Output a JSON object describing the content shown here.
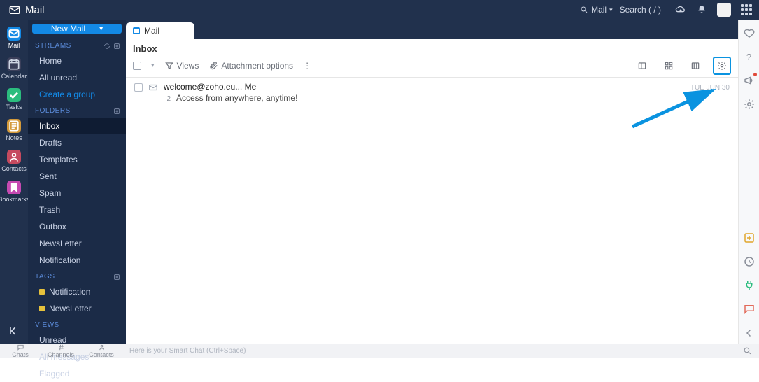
{
  "brand": {
    "title": "Mail"
  },
  "topsearch": {
    "scope": "Mail",
    "placeholder": "Search ( / )"
  },
  "rail": [
    {
      "key": "mail",
      "label": "Mail",
      "active": true
    },
    {
      "key": "calendar",
      "label": "Calendar"
    },
    {
      "key": "tasks",
      "label": "Tasks"
    },
    {
      "key": "notes",
      "label": "Notes"
    },
    {
      "key": "contacts",
      "label": "Contacts"
    },
    {
      "key": "bookmarks",
      "label": "Bookmarks"
    }
  ],
  "compose_label": "New Mail",
  "sidebar": {
    "streams_title": "STREAMS",
    "streams": [
      {
        "label": "Home"
      },
      {
        "label": "All unread"
      },
      {
        "label": "Create a group",
        "link": true
      }
    ],
    "folders_title": "FOLDERS",
    "folders": [
      {
        "label": "Inbox",
        "active": true
      },
      {
        "label": "Drafts"
      },
      {
        "label": "Templates"
      },
      {
        "label": "Sent"
      },
      {
        "label": "Spam"
      },
      {
        "label": "Trash"
      },
      {
        "label": "Outbox"
      },
      {
        "label": "NewsLetter"
      },
      {
        "label": "Notification"
      }
    ],
    "tags_title": "TAGS",
    "tags": [
      {
        "label": "Notification"
      },
      {
        "label": "NewsLetter"
      }
    ],
    "views_title": "VIEWS",
    "views": [
      {
        "label": "Unread"
      },
      {
        "label": "All messages"
      },
      {
        "label": "Flagged"
      }
    ]
  },
  "tab": {
    "label": "Mail"
  },
  "list": {
    "title": "Inbox",
    "views_label": "Views",
    "attach_label": "Attachment options",
    "messages": [
      {
        "from": "welcome@zoho.eu... Me",
        "count": "2",
        "subject": "Access from anywhere, anytime!",
        "date": "TUE JUN 30"
      }
    ]
  },
  "bottom": {
    "tabs": [
      "Chats",
      "Channels",
      "Contacts"
    ],
    "chat_placeholder": "Here is your Smart Chat (Ctrl+Space)"
  }
}
